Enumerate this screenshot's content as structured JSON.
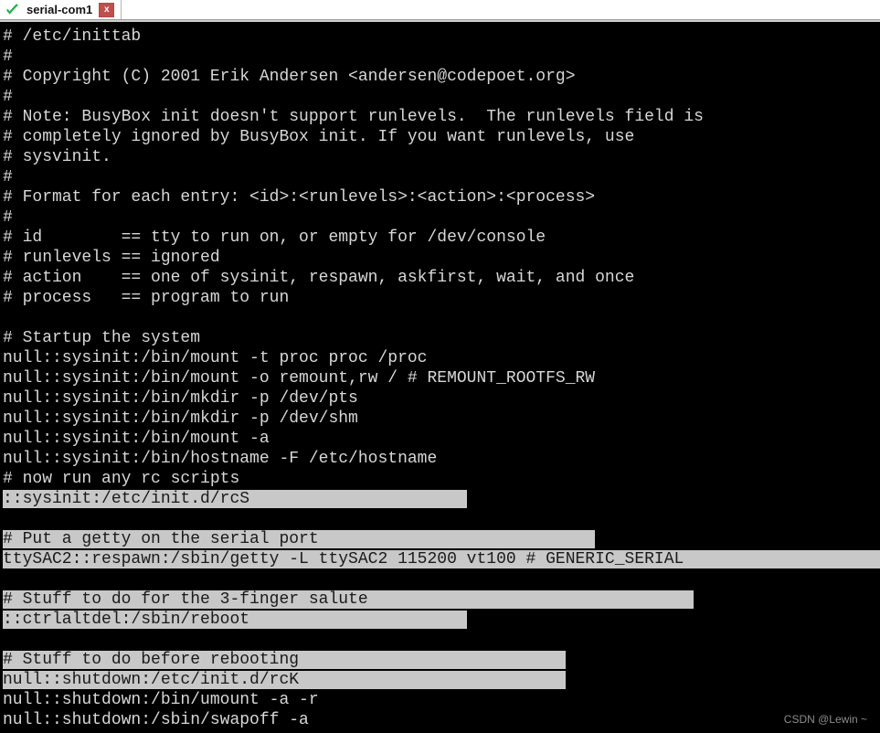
{
  "window": {
    "title": "serial-com1"
  },
  "tabbar": {
    "tabs": [
      {
        "label": "serial-com1",
        "status_icon": "green-check-icon",
        "close_label": "x"
      }
    ]
  },
  "terminal": {
    "background_color": "#000000",
    "foreground_color": "#d7d7d7",
    "selection_background_color": "#c8c8c8",
    "selection_foreground_color": "#1a1a1a",
    "columns": 70,
    "rows": 35,
    "lines": [
      {
        "text": "# /etc/inittab",
        "selected": false,
        "selection_cells": 0
      },
      {
        "text": "#",
        "selected": false,
        "selection_cells": 0
      },
      {
        "text": "# Copyright (C) 2001 Erik Andersen <andersen@codepoet.org>",
        "selected": false,
        "selection_cells": 0
      },
      {
        "text": "#",
        "selected": false,
        "selection_cells": 0
      },
      {
        "text": "# Note: BusyBox init doesn't support runlevels.  The runlevels field is",
        "selected": false,
        "selection_cells": 0
      },
      {
        "text": "# completely ignored by BusyBox init. If you want runlevels, use",
        "selected": false,
        "selection_cells": 0
      },
      {
        "text": "# sysvinit.",
        "selected": false,
        "selection_cells": 0
      },
      {
        "text": "#",
        "selected": false,
        "selection_cells": 0
      },
      {
        "text": "# Format for each entry: <id>:<runlevels>:<action>:<process>",
        "selected": false,
        "selection_cells": 0
      },
      {
        "text": "#",
        "selected": false,
        "selection_cells": 0
      },
      {
        "text": "# id        == tty to run on, or empty for /dev/console",
        "selected": false,
        "selection_cells": 0
      },
      {
        "text": "# runlevels == ignored",
        "selected": false,
        "selection_cells": 0
      },
      {
        "text": "# action    == one of sysinit, respawn, askfirst, wait, and once",
        "selected": false,
        "selection_cells": 0
      },
      {
        "text": "# process   == program to run",
        "selected": false,
        "selection_cells": 0
      },
      {
        "text": "",
        "selected": false,
        "selection_cells": 0
      },
      {
        "text": "# Startup the system",
        "selected": false,
        "selection_cells": 0
      },
      {
        "text": "null::sysinit:/bin/mount -t proc proc /proc",
        "selected": false,
        "selection_cells": 0
      },
      {
        "text": "null::sysinit:/bin/mount -o remount,rw / # REMOUNT_ROOTFS_RW",
        "selected": false,
        "selection_cells": 0
      },
      {
        "text": "null::sysinit:/bin/mkdir -p /dev/pts",
        "selected": false,
        "selection_cells": 0
      },
      {
        "text": "null::sysinit:/bin/mkdir -p /dev/shm",
        "selected": false,
        "selection_cells": 0
      },
      {
        "text": "null::sysinit:/bin/mount -a",
        "selected": false,
        "selection_cells": 0
      },
      {
        "text": "null::sysinit:/bin/hostname -F /etc/hostname",
        "selected": false,
        "selection_cells": 0
      },
      {
        "text": "# now run any rc scripts",
        "selected": false,
        "selection_cells": 0
      },
      {
        "text": "::sysinit:/etc/init.d/rcS",
        "selected": true,
        "selection_cells": 22
      },
      {
        "text": "",
        "selected": false,
        "selection_cells": 0
      },
      {
        "text": "# Put a getty on the serial port",
        "selected": true,
        "selection_cells": 28
      },
      {
        "text": "ttySAC2::respawn:/sbin/getty -L ttySAC2 115200 vt100 # GENERIC_SERIAL",
        "selected": true,
        "selection_cells": 61
      },
      {
        "text": "",
        "selected": false,
        "selection_cells": 0
      },
      {
        "text": "# Stuff to do for the 3-finger salute",
        "selected": true,
        "selection_cells": 33
      },
      {
        "text": "::ctrlaltdel:/sbin/reboot",
        "selected": true,
        "selection_cells": 22
      },
      {
        "text": "",
        "selected": false,
        "selection_cells": 0
      },
      {
        "text": "# Stuff to do before rebooting",
        "selected": true,
        "selection_cells": 27
      },
      {
        "text": "null::shutdown:/etc/init.d/rcK",
        "selected": true,
        "selection_cells": 27
      },
      {
        "text": "null::shutdown:/bin/umount -a -r",
        "selected": false,
        "selection_cells": 0
      },
      {
        "text": "null::shutdown:/sbin/swapoff -a",
        "selected": false,
        "selection_cells": 0
      }
    ]
  },
  "watermark": {
    "text": "CSDN @Lewin ~"
  }
}
